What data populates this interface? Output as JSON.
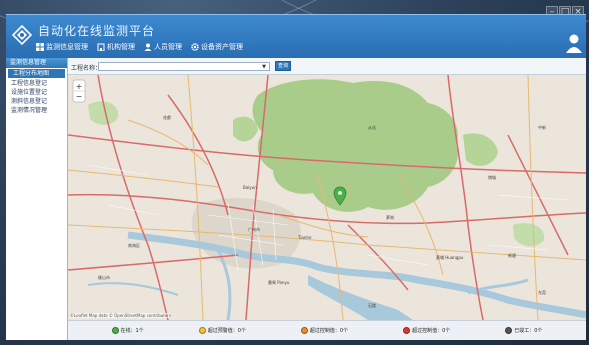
{
  "app": {
    "title": "自动化在线监测平台"
  },
  "window_controls": [
    "–",
    "□",
    "×"
  ],
  "nav": [
    {
      "label": "监测信息管理",
      "icon": "grid-icon"
    },
    {
      "label": "机构管理",
      "icon": "building-icon"
    },
    {
      "label": "人员管理",
      "icon": "person-icon"
    },
    {
      "label": "设备资产管理",
      "icon": "gear-icon"
    }
  ],
  "sidebar": {
    "header": "监测信息管理",
    "items": [
      {
        "label": "工程分布地图",
        "active": true
      },
      {
        "label": "工程信息登记",
        "active": false
      },
      {
        "label": "设施位置登记",
        "active": false
      },
      {
        "label": "测斜信息登记",
        "active": false
      },
      {
        "label": "监测情况管理",
        "active": false
      }
    ]
  },
  "toolbar": {
    "label": "工程名称：",
    "select_value": "",
    "button": "查询"
  },
  "map": {
    "labels": [
      "广州市",
      "Tianhe",
      "Baiyun",
      "从化",
      "增城",
      "黄埔 Huangpu",
      "番禺 Panyu",
      "萝岗",
      "花都",
      "南海区",
      "佛山市",
      "新塘",
      "石楼",
      "东莞",
      "中新"
    ],
    "copyright": "©Leaflet  Map data © OpenStreetMap contributors"
  },
  "legend": [
    {
      "label": "在线：1个",
      "color": "#4bb04a"
    },
    {
      "label": "超过预警值：0个",
      "color": "#f1c234"
    },
    {
      "label": "超过控制值：0个",
      "color": "#ec8a2d"
    },
    {
      "label": "超过控制值：0个",
      "color": "#d43b2f"
    },
    {
      "label": "已竣工：0个",
      "color": "#555555"
    }
  ],
  "colors": {
    "header": "#2a6db2",
    "accent": "#2f75b8",
    "forest": "#a9cc8b",
    "water": "#a8c8dc"
  }
}
